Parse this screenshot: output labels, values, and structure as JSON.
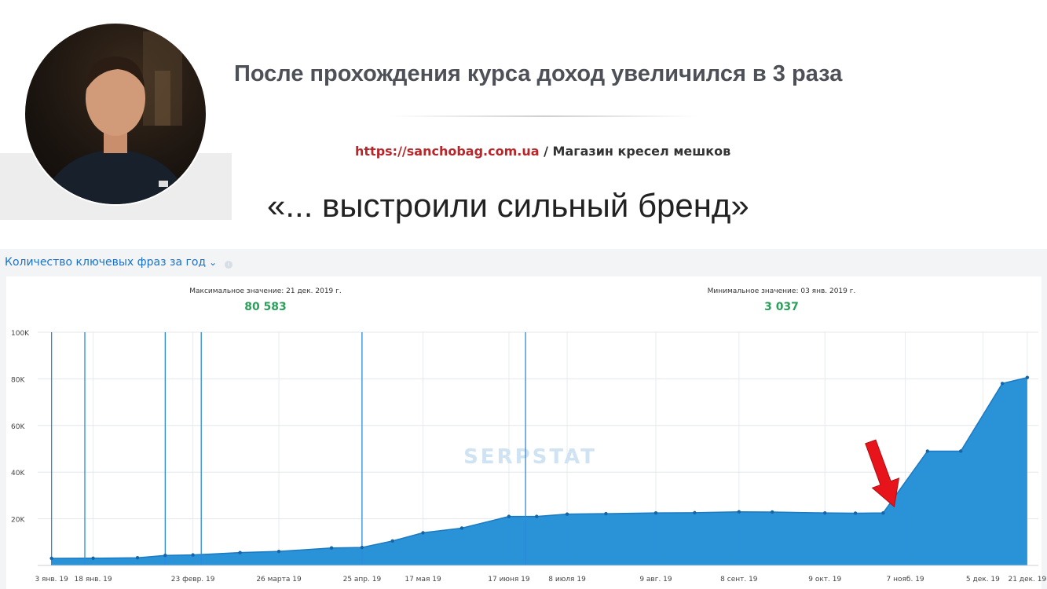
{
  "header": {
    "headline": "После прохождения курса доход увеличился в 3 раза",
    "site_url": "https://sanchobag.com.ua",
    "site_desc": " / Магазин кресел мешков",
    "quote": "«... выстроили сильный бренд»"
  },
  "panel": {
    "title": "Количество ключевых фраз за год",
    "watermark": "SERPSTAT",
    "max_label": "Максимальное значение: 21 дек. 2019 г.",
    "max_value": "80 583",
    "min_label": "Минимальное значение: 03 янв. 2019 г.",
    "min_value": "3 037"
  },
  "colors": {
    "area": "#1f8dd6",
    "line": "#1a7ac2",
    "accent_green": "#2aa05b",
    "title_blue": "#1a73c9",
    "arrow": "#e8141b"
  },
  "chart_data": {
    "type": "area",
    "title": "Количество ключевых фраз за год",
    "ylim": [
      0,
      100000
    ],
    "y_ticks": [
      {
        "value": 100000,
        "label": "100K"
      },
      {
        "value": 80000,
        "label": "80K"
      },
      {
        "value": 60000,
        "label": "60K"
      },
      {
        "value": 40000,
        "label": "40K"
      },
      {
        "value": 20000,
        "label": "20K"
      }
    ],
    "x_ticks": [
      {
        "date": "2019-01-03",
        "label": "3 янв. 19"
      },
      {
        "date": "2019-01-18",
        "label": "18 янв. 19"
      },
      {
        "date": "2019-02-23",
        "label": "23 февр. 19"
      },
      {
        "date": "2019-03-26",
        "label": "26 марта 19"
      },
      {
        "date": "2019-04-25",
        "label": "25 апр. 19"
      },
      {
        "date": "2019-05-17",
        "label": "17 мая 19"
      },
      {
        "date": "2019-06-17",
        "label": "17 июня 19"
      },
      {
        "date": "2019-07-08",
        "label": "8 июля 19"
      },
      {
        "date": "2019-08-09",
        "label": "9 авг. 19"
      },
      {
        "date": "2019-09-08",
        "label": "8 сент. 19"
      },
      {
        "date": "2019-10-09",
        "label": "9 окт. 19"
      },
      {
        "date": "2019-11-07",
        "label": "7 нояб. 19"
      },
      {
        "date": "2019-12-05",
        "label": "5 дек. 19"
      },
      {
        "date": "2019-12-21",
        "label": "21 дек. 19"
      }
    ],
    "series": [
      {
        "points": [
          {
            "date": "2019-01-03",
            "value": 3037
          },
          {
            "date": "2019-01-18",
            "value": 3100
          },
          {
            "date": "2019-02-03",
            "value": 3300
          },
          {
            "date": "2019-02-13",
            "value": 4300
          },
          {
            "date": "2019-02-23",
            "value": 4500
          },
          {
            "date": "2019-03-12",
            "value": 5500
          },
          {
            "date": "2019-03-26",
            "value": 6000
          },
          {
            "date": "2019-04-14",
            "value": 7500
          },
          {
            "date": "2019-04-25",
            "value": 7700
          },
          {
            "date": "2019-05-06",
            "value": 10500
          },
          {
            "date": "2019-05-17",
            "value": 14000
          },
          {
            "date": "2019-05-31",
            "value": 16000
          },
          {
            "date": "2019-06-17",
            "value": 21000
          },
          {
            "date": "2019-06-27",
            "value": 21000
          },
          {
            "date": "2019-07-08",
            "value": 22000
          },
          {
            "date": "2019-07-22",
            "value": 22200
          },
          {
            "date": "2019-08-09",
            "value": 22500
          },
          {
            "date": "2019-08-23",
            "value": 22600
          },
          {
            "date": "2019-09-08",
            "value": 23000
          },
          {
            "date": "2019-09-20",
            "value": 22900
          },
          {
            "date": "2019-10-09",
            "value": 22500
          },
          {
            "date": "2019-10-20",
            "value": 22400
          },
          {
            "date": "2019-10-30",
            "value": 22500
          },
          {
            "date": "2019-11-15",
            "value": 49000
          },
          {
            "date": "2019-11-27",
            "value": 49000
          },
          {
            "date": "2019-12-12",
            "value": 78000
          },
          {
            "date": "2019-12-21",
            "value": 80583
          }
        ]
      }
    ],
    "event_markers": [
      "2019-01-03",
      "2019-01-15",
      "2019-02-13",
      "2019-02-26",
      "2019-04-25",
      "2019-06-23"
    ],
    "annotation": {
      "type": "arrow",
      "target_date": "2019-11-03",
      "color": "#e8141b"
    },
    "grid": true
  }
}
